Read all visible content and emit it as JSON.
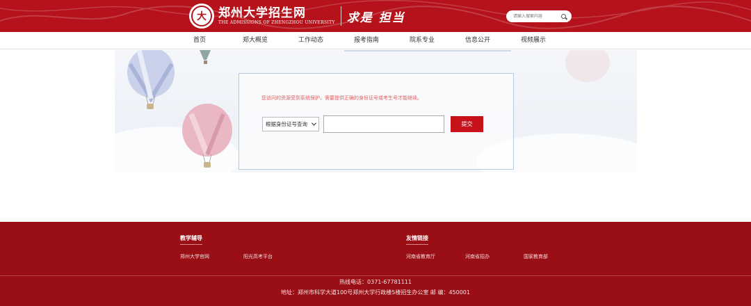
{
  "header": {
    "logo_text": "郑州大学招生网",
    "logo_en": "THE ADMISSIONS OF ZHENGZHOU UNIVERSITY",
    "motto": "求是 担当",
    "emblem_glyph": "大",
    "search_placeholder": "请输入搜索内容",
    "accent_color": "#b5121b"
  },
  "nav": {
    "items": [
      {
        "label": "首页"
      },
      {
        "label": "郑大概览"
      },
      {
        "label": "工作动态"
      },
      {
        "label": "报考指南"
      },
      {
        "label": "院系专业"
      },
      {
        "label": "信息公开"
      },
      {
        "label": "视频展示"
      }
    ]
  },
  "query": {
    "notice": "您访问的资源受到系统保护，需要提供正确的身份证号或考生号才能继续。",
    "select_value": "根据身份证号查询",
    "input_value": "",
    "submit_label": "提交"
  },
  "footer": {
    "teaching_heading": "教学辅导",
    "teaching_links": [
      {
        "label": "郑州大学官网"
      },
      {
        "label": "阳光高考平台"
      }
    ],
    "friend_heading": "友情链接",
    "friend_links": [
      {
        "label": "河南省教育厅"
      },
      {
        "label": "河南省招办"
      },
      {
        "label": "国家教育部"
      }
    ],
    "hotline": "热线电话：0371-67781111",
    "address": "地址：郑州市科学大道100号郑州大学行政楼5楼招生办公室    邮  编：450001",
    "background_color": "#9a0f16"
  }
}
